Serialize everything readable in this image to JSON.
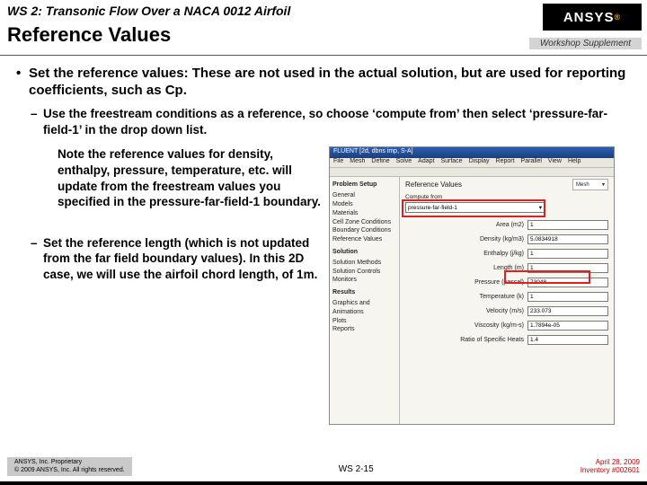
{
  "header": {
    "ws_title": "WS 2: Transonic Flow Over a NACA 0012 Airfoil",
    "section": "Reference Values",
    "logo_text": "ANSYS",
    "supplement": "Workshop Supplement"
  },
  "main_bullet": "Set the reference values:  These are not used in the actual solution, but are used for reporting coefficients, such as Cp.",
  "sub_intro": "Use the freestream conditions as a reference, so choose ‘compute from’ then select ‘pressure-far-field-1’ in the drop down list.",
  "note": "Note the reference values for density, enthalpy, pressure, temperature, etc. will update from the freestream values you specified in the pressure-far-field-1 boundary.",
  "sub_length": "Set the reference length (which is not updated from the far field boundary values). In this 2D case, we will use the airfoil chord length, of 1m.",
  "screenshot": {
    "titlebar": "FLUENT [2d, dbns imp, S-A]",
    "menu": [
      "File",
      "Mesh",
      "Define",
      "Solve",
      "Adapt",
      "Surface",
      "Display",
      "Report",
      "Parallel",
      "View",
      "Help"
    ],
    "tree_header": "Problem Setup",
    "tree_items": [
      "General",
      "Models",
      "Materials",
      "Cell Zone Conditions",
      "Boundary Conditions",
      "Reference Values"
    ],
    "tree_header2": "Solution",
    "tree_items2": [
      "Solution Methods",
      "Solution Controls",
      "Monitors"
    ],
    "tree_header3": "Results",
    "tree_items3": [
      "Graphics and Animations",
      "Plots",
      "Reports"
    ],
    "panel_title": "Reference Values",
    "compute_from_label": "Compute from",
    "compute_from_value": "pressure-far-field-1",
    "mesh_label": "Mesh",
    "fields": [
      {
        "label": "Area (m2)",
        "value": "1"
      },
      {
        "label": "Density (kg/m3)",
        "value": "5.0834918"
      },
      {
        "label": "Enthalpy (j/kg)",
        "value": "1"
      },
      {
        "label": "Length (m)",
        "value": "1"
      },
      {
        "label": "Pressure (pascal)",
        "value": "73048"
      },
      {
        "label": "Temperature (k)",
        "value": "1"
      },
      {
        "label": "Velocity (m/s)",
        "value": "233.073"
      },
      {
        "label": "Viscosity (kg/m-s)",
        "value": "1.7894e-05"
      },
      {
        "label": "Ratio of Specific Heats",
        "value": "1.4"
      }
    ]
  },
  "footer": {
    "proprietary_l1": "ANSYS, Inc. Proprietary",
    "proprietary_l2": "© 2009 ANSYS, Inc. All rights reserved.",
    "page": "WS 2-15",
    "date": "April 28, 2009",
    "inventory": "Inventory #002601"
  }
}
